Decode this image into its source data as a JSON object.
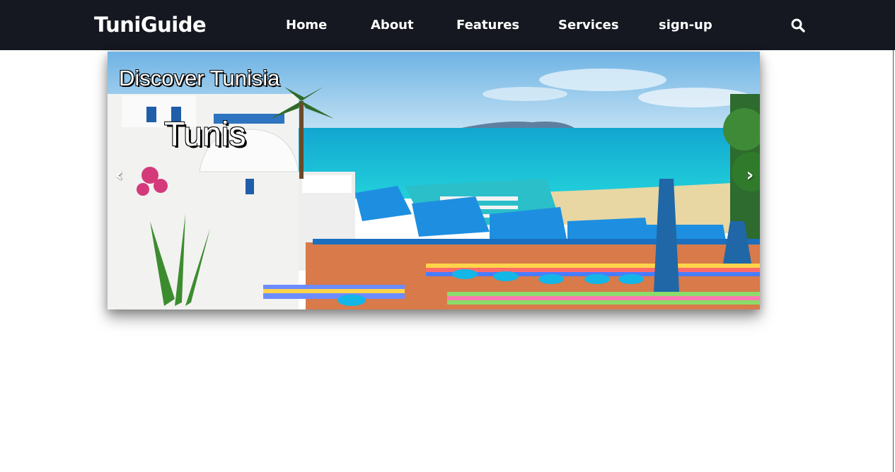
{
  "brand": {
    "title": "TuniGuide"
  },
  "nav": {
    "items": [
      {
        "label": "Home"
      },
      {
        "label": "About"
      },
      {
        "label": "Features"
      },
      {
        "label": "Services"
      },
      {
        "label": "sign-up"
      }
    ],
    "search_icon": "search-icon"
  },
  "slider": {
    "tagline": "Discover Tunisia",
    "city": "Tunis",
    "prev_icon": "‹",
    "next_icon": "›"
  },
  "colors": {
    "navbar_bg": "#151820",
    "nav_text": "#ffffff",
    "sea": "#1bbfd6",
    "sky": "#8fc7ea"
  }
}
